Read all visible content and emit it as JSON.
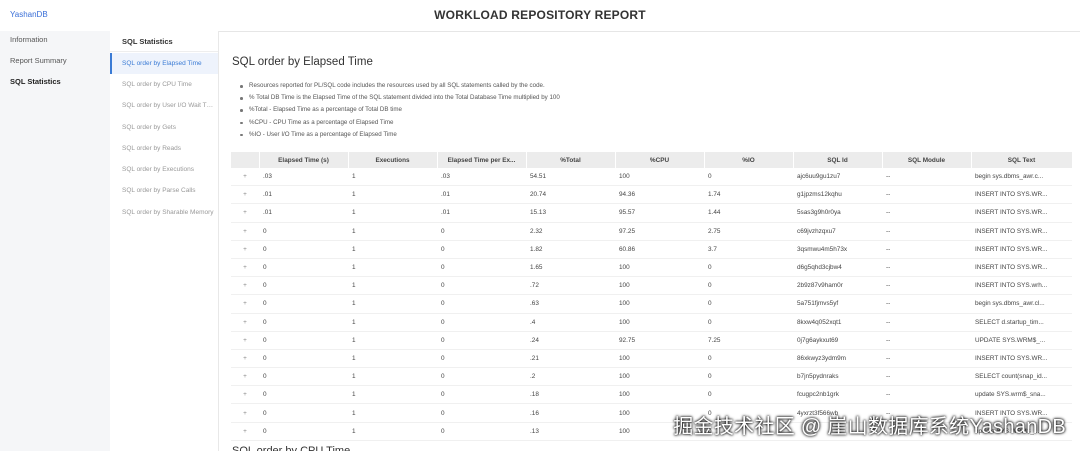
{
  "app": {
    "brand": "YashanDB",
    "report_title": "WORKLOAD REPOSITORY REPORT"
  },
  "left_nav": {
    "items": [
      {
        "label": "Information",
        "active": false
      },
      {
        "label": "Report Summary",
        "active": false
      },
      {
        "label": "SQL Statistics",
        "active": true
      }
    ]
  },
  "sub_nav": {
    "title": "SQL Statistics",
    "items": [
      {
        "label": "SQL order by Elapsed Time",
        "active": true
      },
      {
        "label": "SQL order by CPU Time",
        "active": false
      },
      {
        "label": "SQL order by User I/O Wait T…",
        "active": false
      },
      {
        "label": "SQL order by Gets",
        "active": false
      },
      {
        "label": "SQL order by Reads",
        "active": false
      },
      {
        "label": "SQL order by Executions",
        "active": false
      },
      {
        "label": "SQL order by Parse Calls",
        "active": false
      },
      {
        "label": "SQL order by Sharable Memory",
        "active": false
      }
    ]
  },
  "main": {
    "section_title": "SQL order by Elapsed Time",
    "notes": [
      "Resources reported for PL/SQL code includes the resources used by all SQL statements called by the code.",
      "% Total DB Time is the Elapsed Time of the SQL statement divided into the Total Database Time multiplied by 100",
      "%Total - Elapsed Time as a percentage of Total DB time",
      "%CPU - CPU Time as a percentage of Elapsed Time",
      "%IO - User I/O Time as a percentage of Elapsed Time"
    ],
    "table": {
      "columns": [
        "",
        "Elapsed Time (s)",
        "Executions",
        "Elapsed Time per Ex...",
        "%Total",
        "%CPU",
        "%IO",
        "SQL Id",
        "SQL Module",
        "SQL Text"
      ],
      "rows": [
        [
          "+",
          ".03",
          "1",
          ".03",
          "54.51",
          "100",
          "0",
          "ajc6uu9gu1zu7",
          "--",
          "begin sys.dbms_awr.c..."
        ],
        [
          "+",
          ".01",
          "1",
          ".01",
          "20.74",
          "94.36",
          "1.74",
          "g1jpzms12kqhu",
          "--",
          "INSERT INTO SYS.WR..."
        ],
        [
          "+",
          ".01",
          "1",
          ".01",
          "15.13",
          "95.57",
          "1.44",
          "5sas3g9h0r0ya",
          "--",
          "INSERT INTO SYS.WR..."
        ],
        [
          "+",
          "0",
          "1",
          "0",
          "2.32",
          "97.25",
          "2.75",
          "c69jvzhzqxu7",
          "--",
          "INSERT INTO SYS.WR..."
        ],
        [
          "+",
          "0",
          "1",
          "0",
          "1.82",
          "60.86",
          "3.7",
          "3qsmwu4m5h73x",
          "--",
          "INSERT INTO SYS.WR..."
        ],
        [
          "+",
          "0",
          "1",
          "0",
          "1.65",
          "100",
          "0",
          "d6g5qhd3cjbw4",
          "--",
          "INSERT INTO SYS.WR..."
        ],
        [
          "+",
          "0",
          "1",
          "0",
          ".72",
          "100",
          "0",
          "2b9z87v9ham0r",
          "--",
          "INSERT INTO SYS.wrh..."
        ],
        [
          "+",
          "0",
          "1",
          "0",
          ".63",
          "100",
          "0",
          "5a751fjmvs5yf",
          "--",
          "begin sys.dbms_awr.cl..."
        ],
        [
          "+",
          "0",
          "1",
          "0",
          ".4",
          "100",
          "0",
          "8kxw4q052xqt1",
          "--",
          "SELECT d.startup_tim..."
        ],
        [
          "+",
          "0",
          "1",
          "0",
          ".24",
          "92.75",
          "7.25",
          "0j7g6aykxut69",
          "--",
          "UPDATE SYS.WRM$_..."
        ],
        [
          "+",
          "0",
          "1",
          "0",
          ".21",
          "100",
          "0",
          "86xkwyz3ydm9m",
          "--",
          "INSERT INTO SYS.WR..."
        ],
        [
          "+",
          "0",
          "1",
          "0",
          ".2",
          "100",
          "0",
          "b7jn5pydnraks",
          "--",
          "SELECT count(snap_id..."
        ],
        [
          "+",
          "0",
          "1",
          "0",
          ".18",
          "100",
          "0",
          "fcugpc2nb1grk",
          "--",
          "update SYS.wrm$_sna..."
        ],
        [
          "+",
          "0",
          "1",
          "0",
          ".16",
          "100",
          "0",
          "4yxrzt3f566wb",
          "--",
          "INSERT INTO SYS.WR..."
        ],
        [
          "+",
          "0",
          "1",
          "0",
          ".13",
          "100",
          "0",
          "",
          "",
          "update SYS.WRM$_..."
        ]
      ]
    },
    "next_section_title": "SQL order by CPU Time"
  },
  "watermark": "掘金技术社区 @ 崖山数据库系统YashanDB"
}
